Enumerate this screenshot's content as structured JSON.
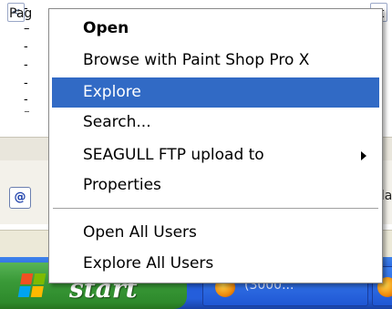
{
  "background": {
    "ruler_marks": [
      "-",
      "–",
      "-",
      "-",
      "-",
      "-",
      "⁻"
    ],
    "hscroll_left_arrow": "<",
    "address_icon": "@",
    "right_edge_text": "lla",
    "status_left": "Pag",
    "status_right": "t"
  },
  "taskbar": {
    "start_label": "start",
    "start_flag_colors": [
      "#f25022",
      "#7fba00",
      "#00a4ef",
      "#ffb900"
    ],
    "task_items": [
      {
        "label": "(3000...",
        "icon": "firefox-icon"
      },
      {
        "label": "",
        "icon": "firefox-icon"
      }
    ]
  },
  "context_menu": {
    "items": [
      {
        "label": "Open",
        "bold": true,
        "highlighted": false,
        "submenu": false
      },
      {
        "label": "Browse with Paint Shop Pro X",
        "bold": false,
        "highlighted": false,
        "submenu": false
      },
      {
        "label": "Explore",
        "bold": false,
        "highlighted": true,
        "submenu": false
      },
      {
        "label": "Search...",
        "bold": false,
        "highlighted": false,
        "submenu": false
      },
      {
        "label": "SEAGULL FTP upload to",
        "bold": false,
        "highlighted": false,
        "submenu": true
      },
      {
        "label": "Properties",
        "bold": false,
        "highlighted": false,
        "submenu": false
      },
      {
        "label": "Open All Users",
        "bold": false,
        "highlighted": false,
        "submenu": false
      },
      {
        "label": "Explore All Users",
        "bold": false,
        "highlighted": false,
        "submenu": false
      }
    ],
    "highlight_color": "#316ac5"
  }
}
